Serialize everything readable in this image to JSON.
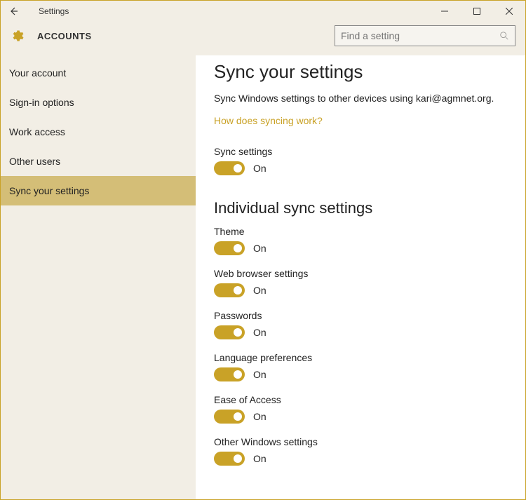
{
  "window": {
    "title": "Settings"
  },
  "header": {
    "title": "ACCOUNTS",
    "search_placeholder": "Find a setting"
  },
  "sidebar": {
    "items": [
      {
        "label": "Your account",
        "selected": false
      },
      {
        "label": "Sign-in options",
        "selected": false
      },
      {
        "label": "Work access",
        "selected": false
      },
      {
        "label": "Other users",
        "selected": false
      },
      {
        "label": "Sync your settings",
        "selected": true
      }
    ]
  },
  "main": {
    "heading": "Sync your settings",
    "description": "Sync Windows settings to other devices using kari@agmnet.org.",
    "link": "How does syncing work?",
    "sync_settings": {
      "label": "Sync settings",
      "state": "On"
    },
    "individual_heading": "Individual sync settings",
    "individual": [
      {
        "label": "Theme",
        "state": "On"
      },
      {
        "label": "Web browser settings",
        "state": "On"
      },
      {
        "label": "Passwords",
        "state": "On"
      },
      {
        "label": "Language preferences",
        "state": "On"
      },
      {
        "label": "Ease of Access",
        "state": "On"
      },
      {
        "label": "Other Windows settings",
        "state": "On"
      }
    ]
  },
  "colors": {
    "accent": "#c9a227"
  }
}
